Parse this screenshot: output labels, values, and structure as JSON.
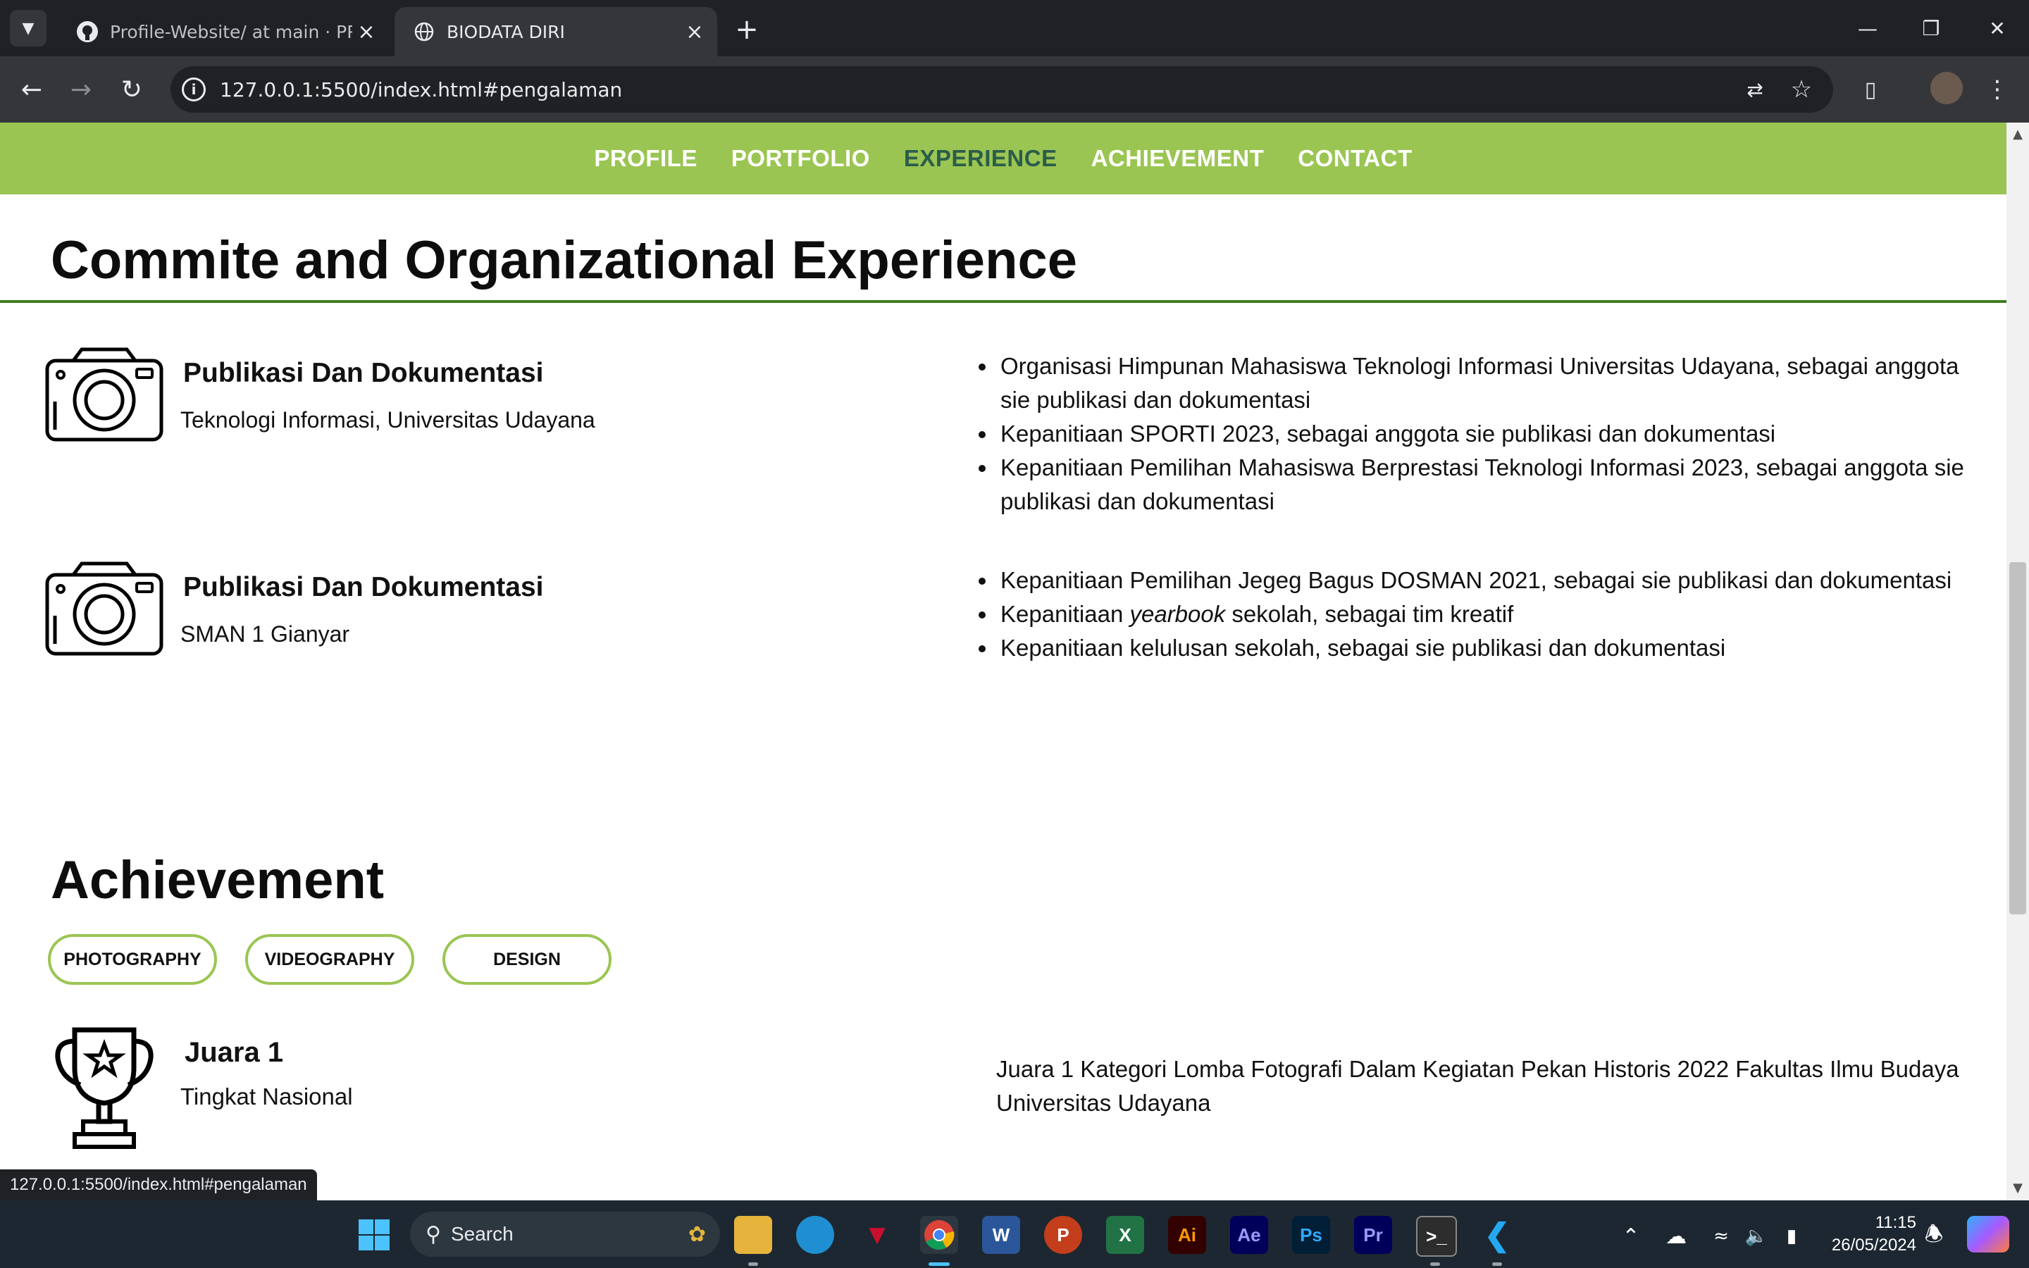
{
  "browser": {
    "tabs": [
      {
        "title": "Profile-Website/ at main · PRisa",
        "active": false
      },
      {
        "title": "BIODATA DIRI",
        "active": true
      }
    ],
    "url": "127.0.0.1:5500/index.html#pengalaman",
    "status_url": "127.0.0.1:5500/index.html#pengalaman"
  },
  "nav": {
    "items": [
      "PROFILE",
      "PORTFOLIO",
      "EXPERIENCE",
      "ACHIEVEMENT",
      "CONTACT"
    ],
    "active": "EXPERIENCE"
  },
  "experience": {
    "title": "Commite and Organizational Experience",
    "entries": [
      {
        "role": "Publikasi Dan Dokumentasi",
        "org": "Teknologi Informasi, Universitas Udayana",
        "items": [
          "Organisasi Himpunan Mahasiswa Teknologi Informasi Universitas Udayana, sebagai anggota sie publikasi dan dokumentasi",
          "Kepanitiaan SPORTI 2023, sebagai anggota sie publikasi dan dokumentasi",
          "Kepanitiaan Pemilihan Mahasiswa Berprestasi Teknologi Informasi 2023, sebagai anggota sie publikasi dan dokumentasi"
        ]
      },
      {
        "role": "Publikasi Dan Dokumentasi",
        "org": "SMAN 1 Gianyar",
        "items": [
          "Kepanitiaan Pemilihan Jegeg Bagus DOSMAN 2021, sebagai sie publikasi dan dokumentasi",
          "Kepanitiaan yearbook sekolah, sebagai tim kreatif",
          "Kepanitiaan kelulusan sekolah, sebagai sie publikasi dan dokumentasi"
        ],
        "item2_parts": {
          "pre": "Kepanitiaan ",
          "em": "yearbook",
          "post": " sekolah, sebagai tim kreatif"
        }
      }
    ]
  },
  "achievement": {
    "title": "Achievement",
    "filters": [
      "PHOTOGRAPHY",
      "VIDEOGRAPHY",
      "DESIGN"
    ],
    "items": [
      {
        "title": "Juara 1",
        "level": "Tingkat Nasional",
        "description": "Juara 1 Kategori Lomba Fotografi Dalam Kegiatan Pekan Historis 2022 Fakultas Ilmu Budaya Universitas Udayana"
      }
    ]
  },
  "taskbar": {
    "search_placeholder": "Search",
    "apps": [
      "file-explorer",
      "edge",
      "mcafee",
      "chrome",
      "word",
      "powerpoint",
      "excel",
      "illustrator",
      "after-effects",
      "photoshop",
      "premiere",
      "terminal",
      "vscode"
    ],
    "app_labels": {
      "word": "W",
      "powerpoint": "P",
      "excel": "X",
      "illustrator": "Ai",
      "after-effects": "Ae",
      "photoshop": "Ps",
      "premiere": "Pr"
    },
    "time": "11:15",
    "date": "26/05/2024"
  },
  "colors": {
    "nav_bg": "#9bc553",
    "nav_active": "#2b5d4a",
    "divider": "#3c7d1d",
    "pill_border": "#9bc553"
  }
}
